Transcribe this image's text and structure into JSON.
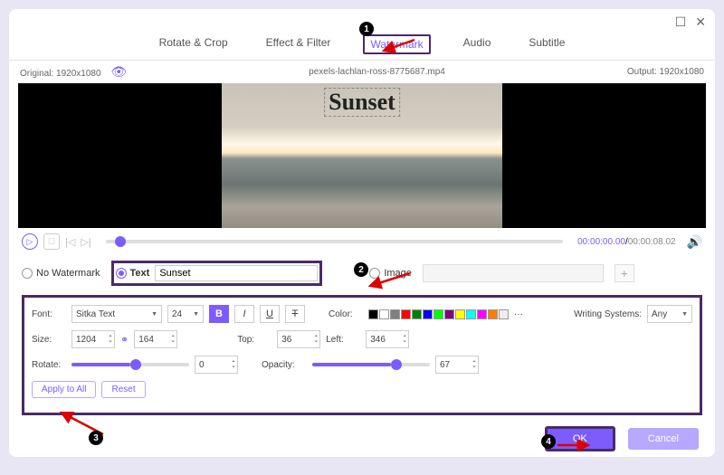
{
  "titlebar": {
    "max": "☐",
    "close": "✕"
  },
  "tabs": {
    "rotate": "Rotate & Crop",
    "effect": "Effect & Filter",
    "watermark": "Watermark",
    "audio": "Audio",
    "subtitle": "Subtitle"
  },
  "info": {
    "original_label": "Original:",
    "original_res": "1920x1080",
    "filename": "pexels-lachlan-ross-8775687.mp4",
    "output_label": "Output:",
    "output_res": "1920x1080"
  },
  "watermark_text": "Sunset",
  "time": {
    "current": "00:00:00.00",
    "duration": "00:00:08.02"
  },
  "radio": {
    "no_wm": "No Watermark",
    "text": "Text",
    "text_value": "Sunset",
    "image": "Image"
  },
  "settings": {
    "font_label": "Font:",
    "font_name": "Sitka Text",
    "font_size": "24",
    "bold": "B",
    "italic": "I",
    "underline": "U",
    "strike": "T",
    "color_label": "Color:",
    "swatches": [
      "#000000",
      "#ffffff",
      "#808080",
      "#ff0000",
      "#008000",
      "#0000ff",
      "#00ff00",
      "#800080",
      "#ffff00",
      "#00ffff",
      "#ff00ff",
      "#ff8000",
      "#eeeeee"
    ],
    "more": "···",
    "ws_label": "Writing Systems:",
    "ws_value": "Any",
    "size_label": "Size:",
    "size_w": "1204",
    "size_h": "164",
    "top_label": "Top:",
    "top_v": "36",
    "left_label": "Left:",
    "left_v": "346",
    "rotate_label": "Rotate:",
    "rotate_v": "0",
    "opacity_label": "Opacity:",
    "opacity_v": "67",
    "apply_all": "Apply to All",
    "reset": "Reset"
  },
  "footer": {
    "ok": "OK",
    "cancel": "Cancel"
  },
  "callouts": {
    "c1": "1",
    "c2": "2",
    "c3": "3",
    "c4": "4"
  }
}
